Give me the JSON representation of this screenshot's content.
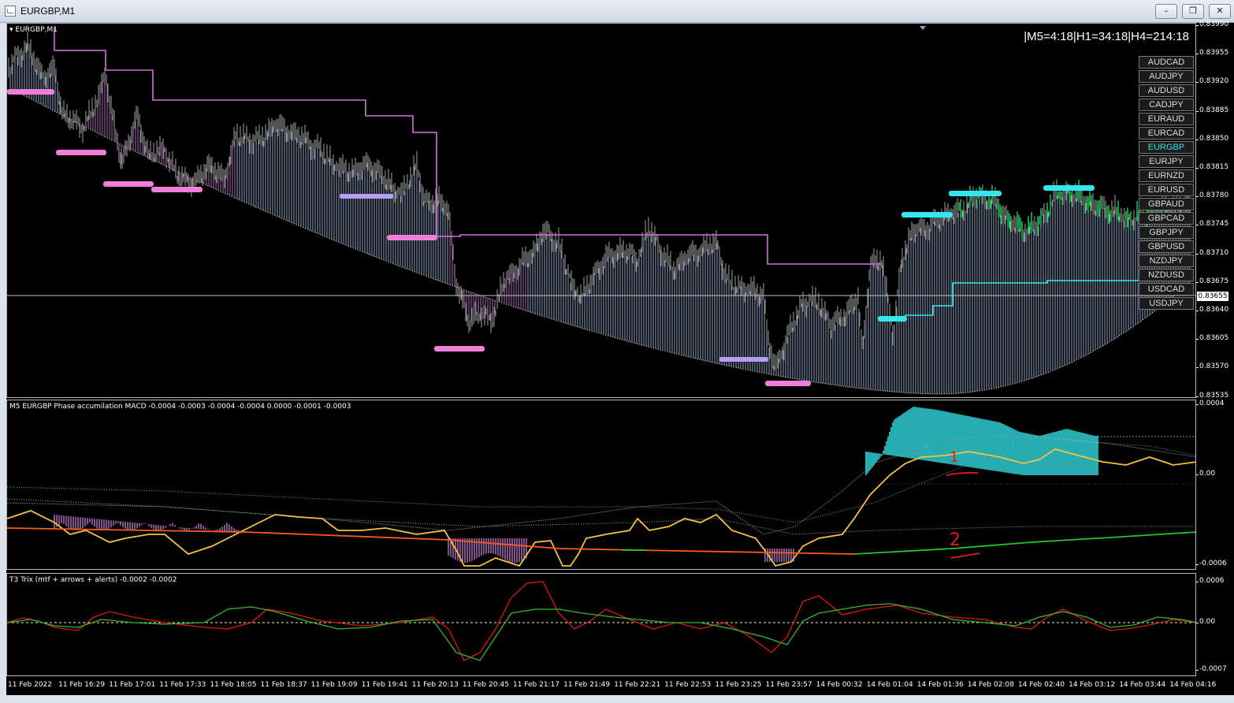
{
  "window": {
    "title": "EURGBP,M1",
    "controls": {
      "minimize": "–",
      "restore": "❐",
      "close": "✕"
    }
  },
  "chart": {
    "label": "EURGBP,M1",
    "timer": "|M5=4:18|H1=34:18|H4=214:18",
    "current_price": "0.83655",
    "symbols": [
      "AUDCAD",
      "AUDJPY",
      "AUDUSD",
      "CADJPY",
      "EURAUD",
      "EURCAD",
      "EURGBP",
      "EURJPY",
      "EURNZD",
      "EURUSD",
      "GBPAUD",
      "GBPCAD",
      "GBPJPY",
      "GBPUSD",
      "NZDJPY",
      "NZDUSD",
      "USDCAD",
      "USDJPY"
    ],
    "active_symbol": "EURGBP",
    "price_ticks": [
      "0.83990",
      "0.83955",
      "0.83920",
      "0.83885",
      "0.83850",
      "0.83815",
      "0.83780",
      "0.83745",
      "0.83710",
      "0.83675",
      "0.83640",
      "0.83605",
      "0.83570",
      "0.83535"
    ]
  },
  "macd_pane": {
    "title": "M5 EURGBP Phase accumilation MACD -0.0004 -0.0003 -0.0004 -0.0004 0.0000 -0.0001 -0.0003",
    "ticks": [
      "0.0004",
      "0.00",
      "-0.0006"
    ],
    "annotations": [
      "1",
      "2"
    ]
  },
  "trix_pane": {
    "title": "T3 Trix (mtf + arrows + alerts) -0.0002 -0.0002",
    "ticks": [
      "0.0006",
      "0.00",
      "-0.0007"
    ]
  },
  "time_ticks": [
    "11 Feb 2022",
    "11 Feb 16:29",
    "11 Feb 17:01",
    "11 Feb 17:33",
    "11 Feb 18:05",
    "11 Feb 18:37",
    "11 Feb 19:09",
    "11 Feb 19:41",
    "11 Feb 20:13",
    "11 Feb 20:45",
    "11 Feb 21:17",
    "11 Feb 21:49",
    "11 Feb 22:21",
    "11 Feb 22:53",
    "11 Feb 23:25",
    "11 Feb 23:57",
    "14 Feb 00:32",
    "14 Feb 01:04",
    "14 Feb 01:36",
    "14 Feb 02:08",
    "14 Feb 02:40",
    "14 Feb 03:12",
    "14 Feb 03:44",
    "14 Feb 04:16"
  ],
  "colors": {
    "background": "#000000",
    "bars": "#8a8a8a",
    "histogram_blue": "#a9c6ee",
    "histogram_purple": "#c77dd6",
    "stairs": "#d26fdc",
    "support_pink": "#ef7fd8",
    "resistance_cyan": "#34e6ee",
    "macd_yellow": "#f5c242",
    "signal_orange": "#ff5a1e",
    "signal_green": "#22c92a",
    "trix_red": "#e01616",
    "trix_green": "#2ebb2e"
  }
}
